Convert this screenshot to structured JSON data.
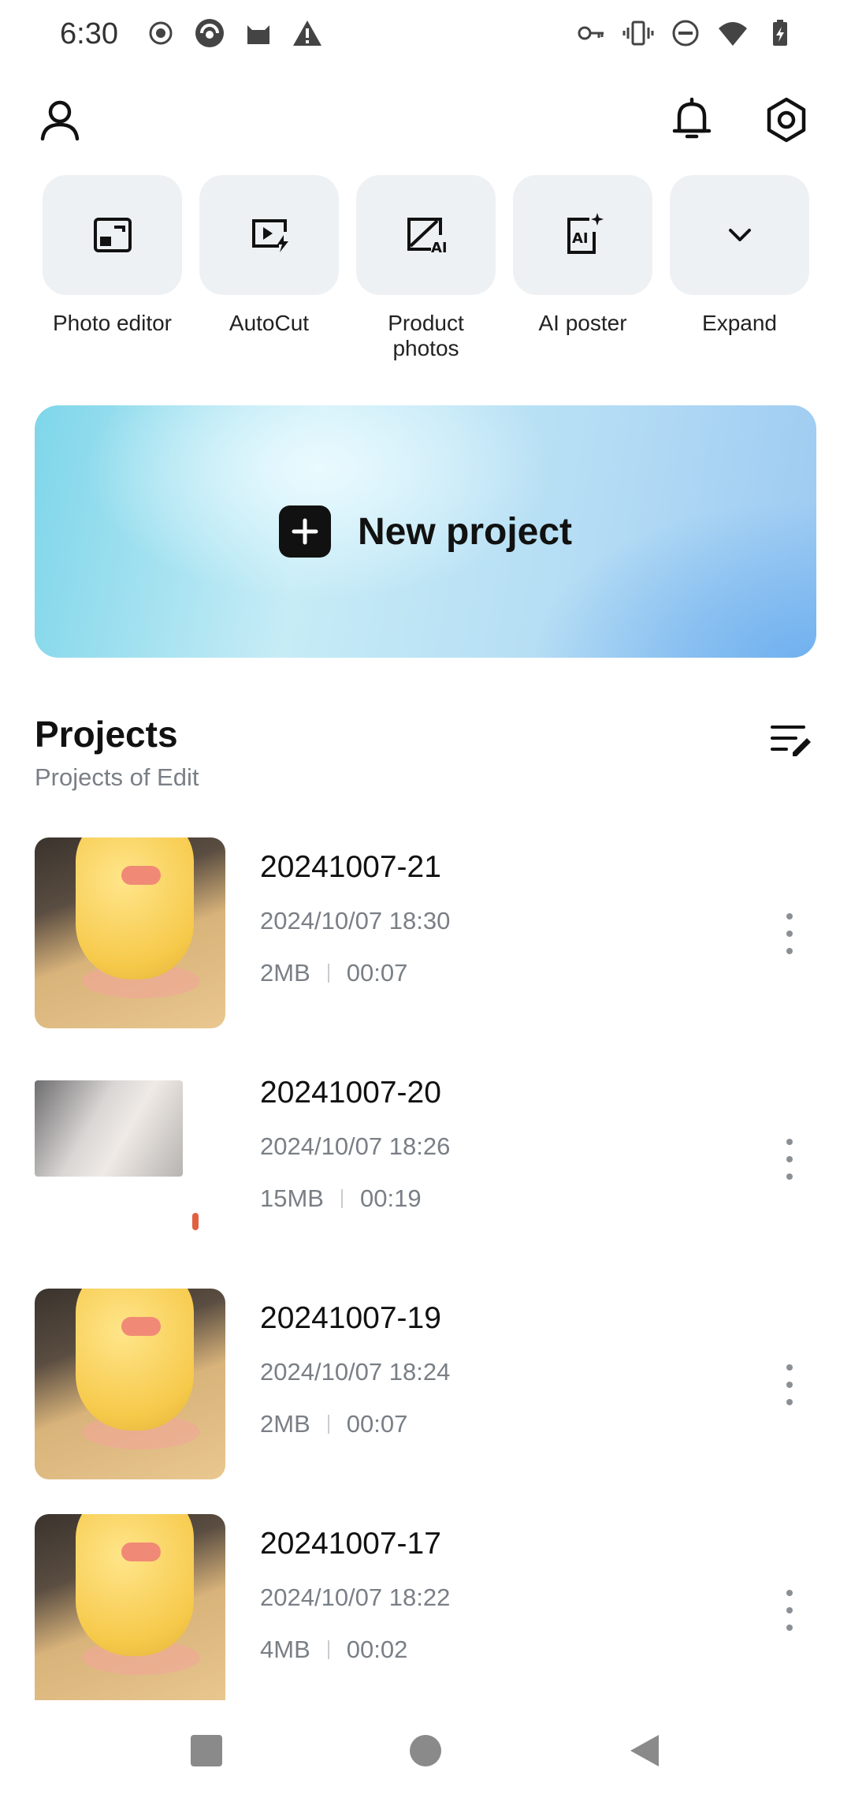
{
  "status_bar": {
    "time": "6:30",
    "left_icons": [
      "record-icon",
      "app-icon",
      "cat-icon",
      "warning-icon"
    ],
    "right_icons": [
      "vpn-key-icon",
      "vibrate-icon",
      "dnd-icon",
      "wifi-icon",
      "battery-icon"
    ]
  },
  "header": {
    "profile_icon": "person-icon",
    "notification_icon": "bell-icon",
    "settings_icon": "settings-icon"
  },
  "tools": [
    {
      "label": "Photo editor",
      "icon": "photo-editor-icon"
    },
    {
      "label": "AutoCut",
      "icon": "autocut-icon"
    },
    {
      "label": "Product photos",
      "icon": "product-photos-icon"
    },
    {
      "label": "AI poster",
      "icon": "ai-poster-icon"
    },
    {
      "label": "Expand",
      "icon": "chevron-down-icon"
    }
  ],
  "new_project": {
    "label": "New project"
  },
  "projects": {
    "title": "Projects",
    "subtitle": "Projects of Edit",
    "items": [
      {
        "name": "20241007-21",
        "date": "2024/10/07 18:30",
        "size": "2MB",
        "duration": "00:07"
      },
      {
        "name": "20241007-20",
        "date": "2024/10/07 18:26",
        "size": "15MB",
        "duration": "00:19"
      },
      {
        "name": "20241007-19",
        "date": "2024/10/07 18:24",
        "size": "2MB",
        "duration": "00:07"
      },
      {
        "name": "20241007-17",
        "date": "2024/10/07 18:22",
        "size": "4MB",
        "duration": "00:02"
      }
    ]
  },
  "colors": {
    "tile_bg": "#eef1f4",
    "muted_text": "#7a7f86",
    "banner_start": "#7fd6ea",
    "banner_end": "#6fb0ef"
  }
}
